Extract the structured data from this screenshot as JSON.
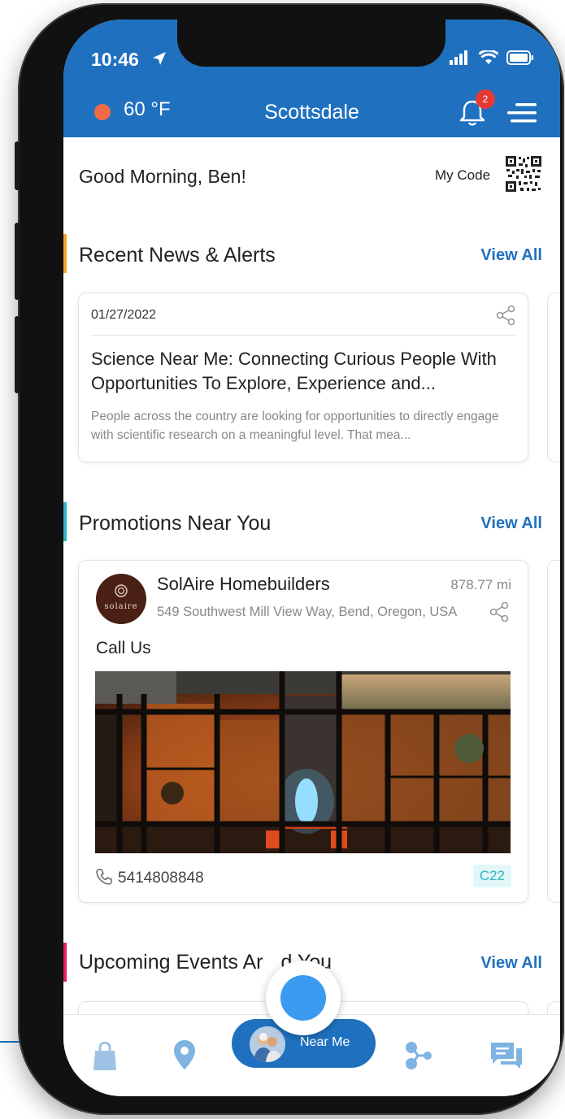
{
  "status_bar": {
    "time": "10:46"
  },
  "header": {
    "temperature": "60 °F",
    "city": "Scottsdale",
    "notification_count": "2",
    "accent_color": "#1f71bf",
    "temp_dot_color": "#f26b49"
  },
  "greeting": {
    "text": "Good Morning, Ben!",
    "my_code_label": "My Code"
  },
  "news": {
    "title": "Recent News & Alerts",
    "view_all": "View All",
    "items": [
      {
        "date": "01/27/2022",
        "title": "Science Near Me: Connecting Curious People With Opportunities To Explore, Experience and...",
        "description": "People across the country are looking for opportunities to directly engage with scientific research on a meaningful level. That mea..."
      }
    ]
  },
  "promotions": {
    "title": "Promotions Near You",
    "view_all": "View All",
    "items": [
      {
        "logo_text": "solaire",
        "name": "SolAire Homebuilders",
        "distance": "878.77 mi",
        "address": "549 Southwest Mill View Way, Bend, Oregon, USA",
        "cta": "Call Us",
        "phone": "5414808848",
        "tag": "C22"
      }
    ]
  },
  "events": {
    "title": "Upcoming Events Ar",
    "title_end": "d You",
    "view_all": "View All"
  },
  "bottom_nav": {
    "items": [
      {
        "icon": "shopping-bag-icon"
      },
      {
        "icon": "map-pin-icon"
      },
      {
        "icon": "connections-icon"
      },
      {
        "icon": "chat-icon"
      }
    ],
    "center_label": "Near Me"
  }
}
